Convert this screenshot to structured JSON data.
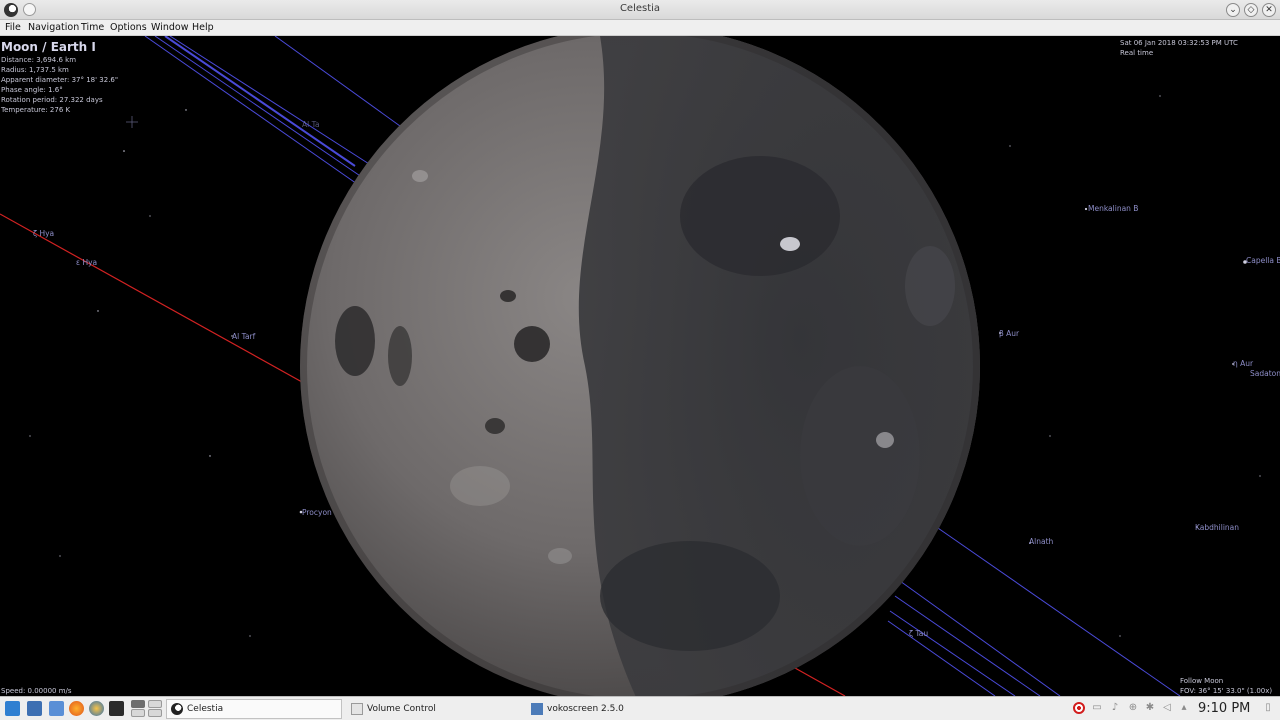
{
  "window": {
    "title": "Celestia"
  },
  "menu": {
    "items": [
      "File",
      "Navigation",
      "Time",
      "Options",
      "Window",
      "Help"
    ]
  },
  "info": {
    "object": "Moon / Earth I",
    "distance": "Distance: 3,694.6 km",
    "radius": "Radius: 1,737.5 km",
    "apparent": "Apparent diameter: 37° 18' 32.6\"",
    "phase": "Phase angle: 1.6°",
    "rotation": "Rotation period: 27.322 days",
    "temperature": "Temperature: 276 K"
  },
  "time": {
    "datetime": "Sat 06 Jan 2018 03:32:53 PM UTC",
    "mode": "Real time"
  },
  "status": {
    "speed": "Speed: 0.00000 m/s",
    "follow": "Follow Moon",
    "fov": "FOV: 36° 15' 33.0\" (1.00x)"
  },
  "labels": {
    "hya1": "ζ Hya",
    "hya2": "ε Hya",
    "altarf": "Al Tarf",
    "procyon": "Procyon",
    "menkalinan": "Menkalinan B",
    "capella": "Capella B",
    "baur": "β Aur",
    "eaur": "η Aur",
    "sadatoni": "Sadatoni",
    "alnath": "Alnath",
    "kabdhilinan": "Kabdhilinan",
    "ztau": "ζ Tau",
    "upper": "Al Ta"
  },
  "taskbar": {
    "tasks": [
      "Celestia",
      "Volume Control",
      "vokoscreen 2.5.0"
    ],
    "clock": "9:10 PM"
  },
  "colors": {
    "orbit_blue": "#4a4ad8",
    "ecliptic_red": "#d22222",
    "label": "#8e8ec8"
  }
}
